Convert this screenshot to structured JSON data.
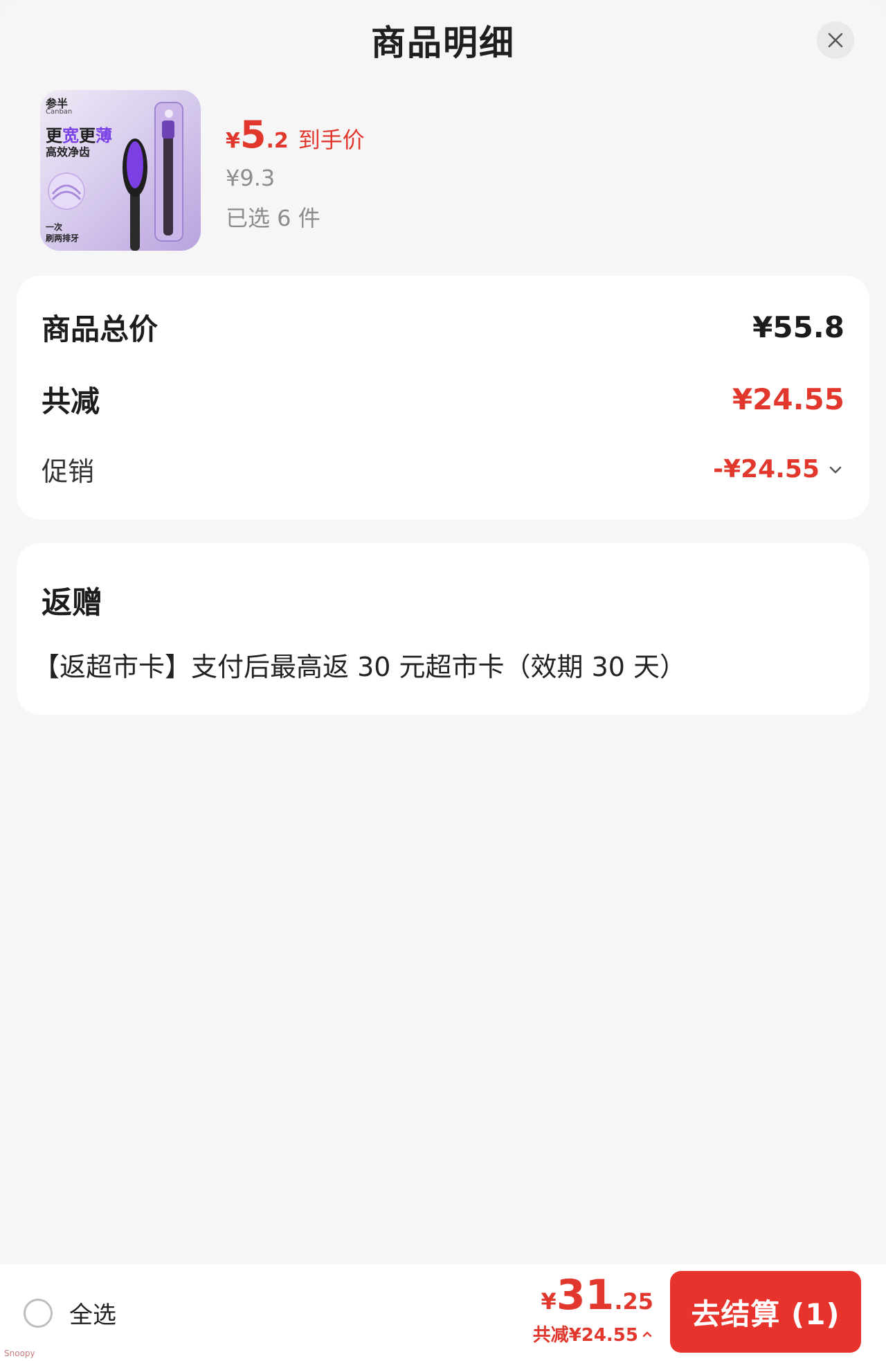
{
  "header": {
    "title": "商品明细"
  },
  "product": {
    "thumb": {
      "brand": "参半",
      "brand_en": "Canban",
      "headline_part1": "更",
      "headline_part2": "宽",
      "headline_part3": "更",
      "headline_part4": "薄",
      "subline": "高效净齿",
      "foot_line1": "一次",
      "foot_line2": "刷两排牙"
    },
    "price_symbol": "¥",
    "price_int": "5",
    "price_dec": ".2",
    "price_tag": "到手价",
    "original_price": "¥9.3",
    "selected_text": "已选 6 件"
  },
  "price_card": {
    "total_label": "商品总价",
    "total_value": "¥55.8",
    "discount_label": "共减",
    "discount_value": "¥24.55",
    "promo_label": "促销",
    "promo_value": "-¥24.55"
  },
  "gift_card": {
    "title": "返赠",
    "text": "【返超市卡】支付后最高返 30 元超市卡（效期 30 天）"
  },
  "bottom_bar": {
    "select_all_label": "全选",
    "total_symbol": "¥",
    "total_int": "31",
    "total_dec": ".25",
    "total_saving": "共减¥24.55",
    "checkout_label": "去结算 (1)"
  },
  "watermark": "Snoopy",
  "colors": {
    "accent_red": "#e2372c",
    "checkout_red": "#e8332c",
    "muted_gray": "#8c8c8c",
    "brand_purple": "#7b43e6"
  }
}
